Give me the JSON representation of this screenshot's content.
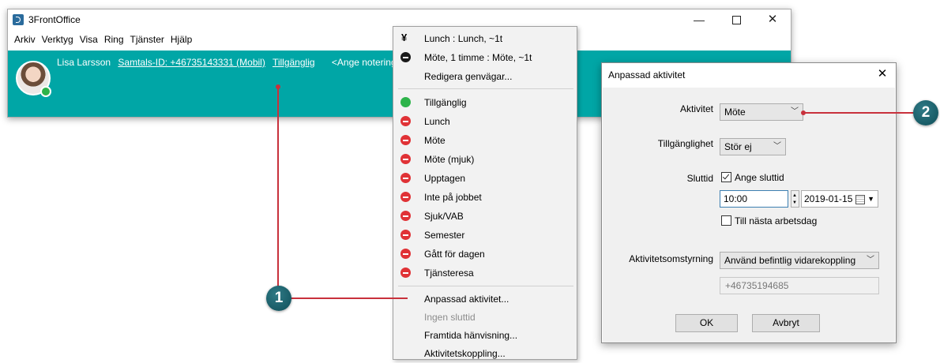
{
  "window": {
    "title": "3FrontOffice",
    "controls": {
      "minimize": "—",
      "maximize": "",
      "close": "✕"
    }
  },
  "menubar": [
    "Arkiv",
    "Verktyg",
    "Visa",
    "Ring",
    "Tjänster",
    "Hjälp"
  ],
  "user": {
    "name": "Lisa Larsson",
    "call_id": "Samtals-ID: +46735143331 (Mobil)",
    "status": "Tillgänglig",
    "note": "<Ange notering>"
  },
  "context_menu": {
    "shortcuts": [
      {
        "label": "Lunch : Lunch, ~1t",
        "icon": "fork-knife-icon"
      },
      {
        "label": "Möte, 1 timme : Möte, ~1t",
        "icon": "busy-black-icon"
      },
      {
        "label": "Redigera genvägar...",
        "icon": ""
      }
    ],
    "statuses": [
      {
        "label": "Tillgänglig",
        "icon": "available-icon"
      },
      {
        "label": "Lunch",
        "icon": "busy-icon"
      },
      {
        "label": "Möte",
        "icon": "busy-icon"
      },
      {
        "label": "Möte (mjuk)",
        "icon": "busy-icon"
      },
      {
        "label": "Upptagen",
        "icon": "busy-icon"
      },
      {
        "label": "Inte på jobbet",
        "icon": "busy-icon"
      },
      {
        "label": "Sjuk/VAB",
        "icon": "busy-icon"
      },
      {
        "label": "Semester",
        "icon": "busy-icon"
      },
      {
        "label": "Gått för dagen",
        "icon": "busy-icon"
      },
      {
        "label": "Tjänsteresa",
        "icon": "busy-icon"
      }
    ],
    "actions": [
      {
        "label": "Anpassad aktivitet...",
        "disabled": false
      },
      {
        "label": "Ingen sluttid",
        "disabled": true
      },
      {
        "label": "Framtida hänvisning...",
        "disabled": false
      },
      {
        "label": "Aktivitetskoppling...",
        "disabled": false
      }
    ]
  },
  "dialog": {
    "title": "Anpassad aktivitet",
    "close": "✕",
    "activity_label": "Aktivitet",
    "activity_value": "Möte",
    "availability_label": "Tillgänglighet",
    "availability_value": "Stör ej",
    "endtime_label": "Sluttid",
    "set_endtime_label": "Ange sluttid",
    "set_endtime_checked": true,
    "time_value": "10:00",
    "date_value": "2019-01-15",
    "next_workday_label": "Till nästa arbetsdag",
    "next_workday_checked": false,
    "routing_label": "Aktivitetsomstyrning",
    "routing_value": "Använd befintlig vidarekoppling",
    "routing_number": "+46735194685",
    "ok": "OK",
    "cancel": "Avbryt"
  },
  "callouts": {
    "one": "1",
    "two": "2"
  },
  "colors": {
    "teal": "#00a6a6",
    "busy_red": "#e03236",
    "available_green": "#2db34a",
    "callout_red": "#c8313c",
    "badge_teal": "#1a5f6a"
  }
}
